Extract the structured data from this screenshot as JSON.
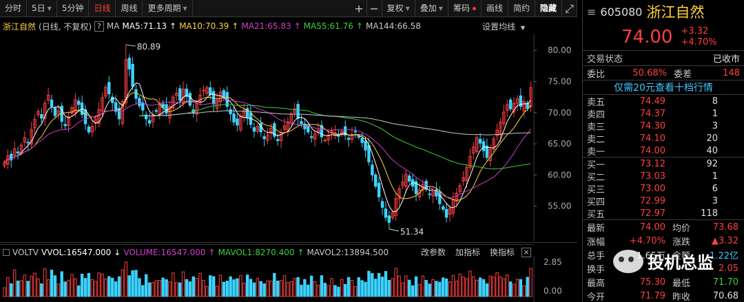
{
  "toolbar": {
    "items": [
      "分时",
      "5日",
      "5分钟",
      "日线",
      "周线",
      "更多周期",
      "复权",
      "叠加",
      "筹码",
      "画线",
      "简约",
      "隐藏"
    ],
    "plus": "+",
    "minus": "−",
    "expand": "⤢"
  },
  "info": {
    "name": "浙江自然",
    "mode": "(日线, 不复权)",
    "q": "?",
    "ma": "MA",
    "ma5": "MA5:71.13",
    "ma10": "MA10:70.39",
    "ma21": "MA21:65.83",
    "ma55": "MA55:61.76",
    "ma144": "MA144:66.58",
    "settings": "设置均线"
  },
  "vol": {
    "label": "VOLTV",
    "vvol": "VVOL:16547.000",
    "volume": "VOLUME:16547.000",
    "mavol1": "MAVOL1:8270.400",
    "mavol2": "MAVOL2:13894.500",
    "change_param": "改参数",
    "add_ind": "加指标",
    "switch_ind": "换指标",
    "close": "×"
  },
  "axis": {
    "price": [
      "80.00",
      "75.00",
      "70.00",
      "65.00",
      "60.00",
      "55.00"
    ],
    "vol": [
      "2.85",
      "0.00"
    ],
    "hi_label": "80.89",
    "lo_label": "51.34"
  },
  "quote": {
    "code": "605080",
    "name": "浙江自然",
    "price": "74.00",
    "change": "+3.32",
    "pct": "+4.70%",
    "status_label": "交易状态",
    "status": "已收市",
    "wb_label": "委比",
    "wb": "50.68%",
    "wc_label": "委差",
    "wc": "148",
    "promo": "仅需20元查看十档行情",
    "asks": [
      {
        "l": "卖五",
        "p": "74.49",
        "v": "8"
      },
      {
        "l": "卖四",
        "p": "74.37",
        "v": "1"
      },
      {
        "l": "卖三",
        "p": "74.30",
        "v": "3"
      },
      {
        "l": "卖二",
        "p": "74.10",
        "v": "20"
      },
      {
        "l": "卖一",
        "p": "74.00",
        "v": "40"
      }
    ],
    "bids": [
      {
        "l": "买一",
        "p": "73.12",
        "v": "92"
      },
      {
        "l": "买二",
        "p": "73.03",
        "v": "1"
      },
      {
        "l": "买三",
        "p": "73.00",
        "v": "6"
      },
      {
        "l": "买四",
        "p": "72.99",
        "v": "3"
      },
      {
        "l": "买五",
        "p": "72.97",
        "v": "118"
      }
    ],
    "stats": [
      {
        "a": "最新",
        "b": "74.00",
        "c": "均价",
        "d": "73.68"
      },
      {
        "a": "涨幅",
        "b": "+4.70%",
        "c": "涨跌",
        "d": "▲3.32"
      },
      {
        "a": "总手",
        "b": "1.65万",
        "c": "金额",
        "d": "1.22亿"
      },
      {
        "a": "换手",
        "b": "",
        "c": "",
        "d": "2.05"
      },
      {
        "a": "最高",
        "b": "75.30",
        "c": "最低",
        "d": "71.70"
      },
      {
        "a": "今开",
        "b": "71.79",
        "c": "昨收",
        "d": "70.68"
      }
    ]
  },
  "watermark": "投机总监",
  "colors": {
    "up": "#ff4040",
    "down": "#3cd2ff",
    "ma5": "#ffffff",
    "ma10": "#ffd23c",
    "ma21": "#d23cd2",
    "ma55": "#3cd23c",
    "ma144": "#c8c8c8"
  },
  "chart_data": {
    "type": "candlestick",
    "period": "daily",
    "ylim": [
      50,
      82
    ],
    "yticks": [
      55,
      60,
      65,
      70,
      75,
      80
    ],
    "high": 80.89,
    "low": 51.34,
    "closes": [
      62.0,
      63.1,
      62.4,
      64.2,
      63.5,
      64.8,
      66.0,
      65.2,
      67.3,
      68.9,
      70.2,
      69.1,
      71.5,
      72.8,
      71.0,
      69.5,
      70.3,
      68.6,
      67.9,
      69.4,
      70.8,
      72.1,
      71.3,
      69.7,
      68.2,
      66.9,
      67.8,
      69.0,
      70.5,
      72.4,
      74.1,
      73.0,
      71.6,
      70.2,
      69.0,
      71.8,
      78.5,
      77.0,
      74.2,
      72.3,
      71.1,
      70.4,
      69.0,
      68.3,
      69.6,
      70.2,
      71.4,
      70.8,
      69.9,
      71.0,
      72.5,
      73.1,
      72.0,
      73.8,
      72.6,
      71.2,
      70.0,
      71.5,
      72.8,
      73.6,
      74.0,
      72.9,
      71.4,
      72.0,
      73.3,
      72.5,
      71.0,
      69.8,
      68.5,
      68.0,
      69.5,
      70.4,
      69.2,
      68.1,
      67.0,
      67.8,
      66.9,
      65.8,
      66.4,
      67.5,
      66.2,
      65.5,
      66.8,
      67.9,
      68.5,
      69.8,
      70.6,
      69.1,
      68.2,
      67.4,
      66.9,
      66.0,
      66.6,
      67.2,
      66.1,
      65.6,
      66.3,
      67.1,
      66.8,
      66.2,
      67.0,
      66.4,
      65.7,
      66.5,
      66.9,
      66.1,
      65.2,
      64.0,
      62.1,
      60.0,
      58.2,
      56.5,
      54.8,
      53.2,
      52.4,
      54.0,
      56.2,
      57.8,
      58.9,
      60.1,
      59.0,
      58.2,
      57.0,
      57.6,
      58.5,
      57.7,
      56.9,
      57.4,
      56.6,
      55.4,
      54.5,
      53.2,
      54.6,
      56.0,
      57.1,
      58.3,
      59.6,
      61.2,
      63.0,
      64.5,
      66.0,
      65.1,
      63.9,
      62.8,
      64.1,
      65.8,
      67.2,
      68.5,
      70.1,
      71.3,
      70.6,
      71.5,
      72.2,
      71.0,
      71.8,
      70.68,
      74.0
    ]
  }
}
